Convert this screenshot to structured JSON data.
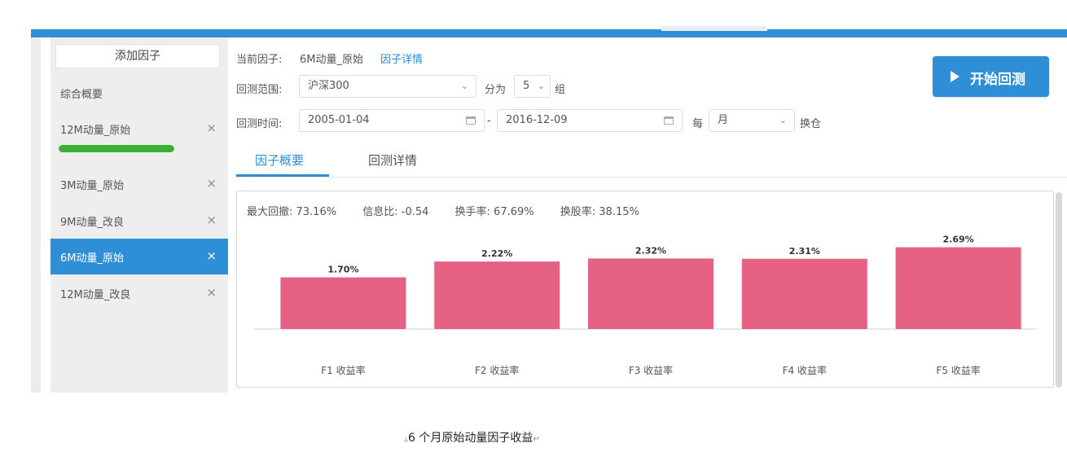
{
  "sidebar": {
    "add_label": "添加因子",
    "overview_label": "综合概要",
    "items": [
      {
        "label": "12M动量_原始",
        "progress": 1.0
      },
      {
        "label": "3M动量_原始"
      },
      {
        "label": "9M动量_改良"
      },
      {
        "label": "6M动量_原始",
        "active": true
      },
      {
        "label": "12M动量_改良"
      }
    ],
    "close_glyph": "×",
    "progress_color": "#3cb034"
  },
  "header": {
    "current_factor_label": "当前因子:",
    "current_factor_value": "6M动量_原始",
    "details_link": "因子详情",
    "range_label": "回测范围:",
    "range_value": "沪深300",
    "group_prefix": "分为",
    "group_value": "5",
    "group_suffix": "组",
    "time_label": "回测时间:",
    "start_date": "2005-01-04",
    "date_sep": "-",
    "end_date": "2016-12-09",
    "every_label": "每",
    "freq_value": "月",
    "rebalance_label": "换仓",
    "start_button": "开始回测"
  },
  "tabs": [
    {
      "label": "因子概要",
      "active": true
    },
    {
      "label": "回测详情",
      "active": false
    }
  ],
  "metrics": {
    "max_drawdown": "最大回撤: 73.16%",
    "info_ratio": "信息比: -0.54",
    "turnover": "换手率: 67.69%",
    "stock_turnover": "换股率: 38.15%"
  },
  "chart_data": {
    "type": "bar",
    "categories": [
      "F1 收益率",
      "F2 收益率",
      "F3 收益率",
      "F4 收益率",
      "F5 收益率"
    ],
    "values": [
      1.7,
      2.22,
      2.32,
      2.31,
      2.69
    ],
    "value_labels": [
      "1.70%",
      "2.22%",
      "2.32%",
      "2.31%",
      "2.69%"
    ],
    "ylim": [
      0,
      3.0
    ],
    "bar_color": "#e56285",
    "grid": false
  },
  "caption": {
    "mark": "▵",
    "text": "6 个月原始动量因子收益",
    "end_mark": "↵"
  },
  "colors": {
    "accent": "#2e8ed6"
  }
}
